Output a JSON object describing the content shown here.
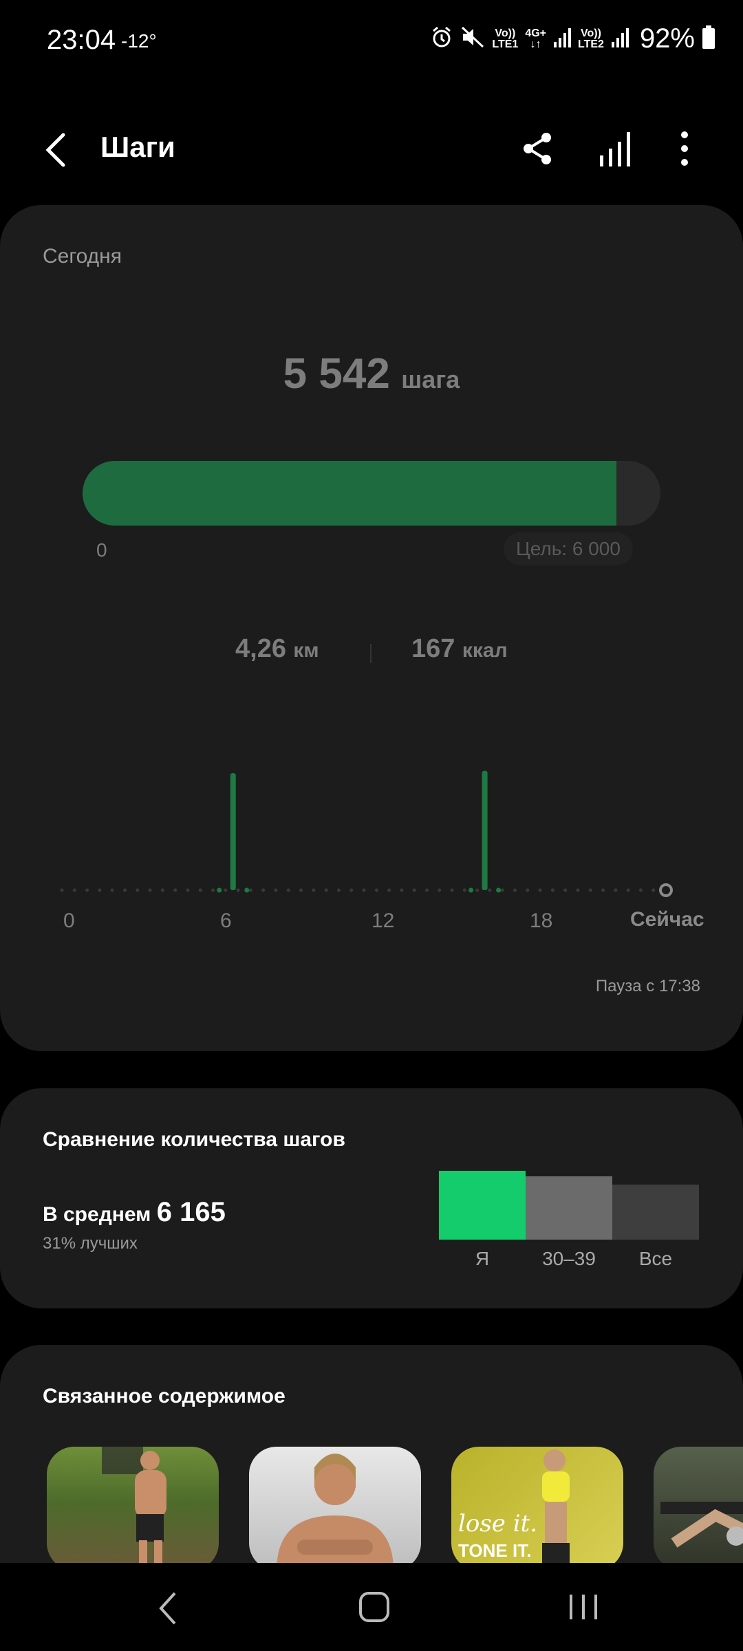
{
  "status_bar": {
    "time": "23:04",
    "temperature": "-12°",
    "sim1_top": "Vo))",
    "sim1_bottom": "LTE1",
    "net_top": "4G+",
    "net_bottom": "↓↑",
    "sim2_top": "Vo))",
    "sim2_bottom": "LTE2",
    "battery": "92%"
  },
  "header": {
    "title": "Шаги"
  },
  "today": {
    "label": "Сегодня",
    "steps_value": "5 542",
    "steps_unit": "шага",
    "progress_fraction": 0.924,
    "progress_start": "0",
    "goal_label": "Цель: 6 000",
    "distance_value": "4,26",
    "distance_unit": "км",
    "calories_value": "167",
    "calories_unit": "ккал",
    "chart_axis": [
      "0",
      "6",
      "12",
      "18",
      "Сейчас"
    ],
    "pause_text": "Пауза с 17:38"
  },
  "chart_data": {
    "type": "bar",
    "x": [
      6.8,
      16.8
    ],
    "values": [
      1.0,
      1.02
    ],
    "xlim": [
      0,
      24
    ],
    "xticks": [
      "0",
      "6",
      "12",
      "18",
      "Сейчас"
    ],
    "color": "#1e7a43"
  },
  "compare": {
    "title": "Сравнение количества шагов",
    "avg_label": "В среднем",
    "avg_value": "6 165",
    "better_text": "31% лучших",
    "bars": [
      {
        "label": "Я",
        "level": 1.0,
        "color": "#14cc6b"
      },
      {
        "label": "30–39",
        "level": 0.92,
        "color": "#6b6b6b"
      },
      {
        "label": "Все",
        "level": 0.8,
        "color": "#3e3e3e"
      }
    ]
  },
  "related": {
    "title": "Связанное содержимое",
    "card3_text_1": "lose it.",
    "card3_text_2": "TONE IT."
  },
  "colors": {
    "accent_green": "#1e6b40",
    "bright_green": "#14cc6b",
    "card_bg": "#1c1c1c"
  }
}
